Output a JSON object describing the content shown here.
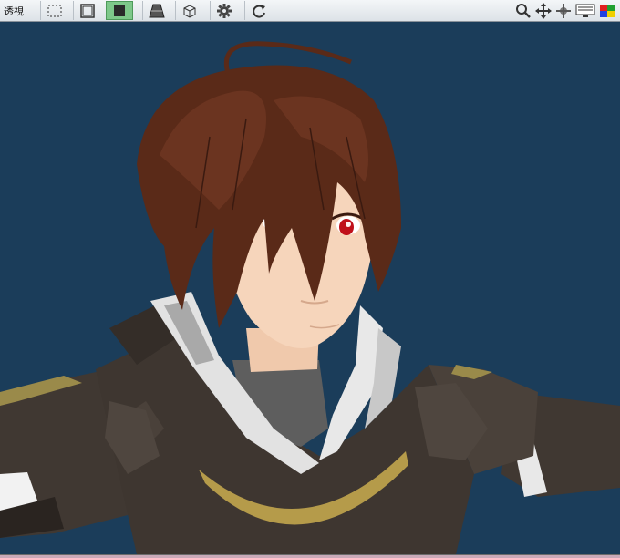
{
  "toolbar": {
    "view_mode_label": "透視",
    "buttons": [
      {
        "name": "select-rect-button",
        "icon": "dashed-square-icon",
        "active": false
      },
      {
        "name": "frame-button",
        "icon": "frame-square-icon",
        "active": false
      },
      {
        "name": "solid-shading-button",
        "icon": "solid-square-icon",
        "active": true
      },
      {
        "name": "texture-shading-button",
        "icon": "trapezoid-icon",
        "active": false
      },
      {
        "name": "wireframe-cube-button",
        "icon": "cube-icon",
        "active": false
      },
      {
        "name": "settings-button",
        "icon": "gear-icon",
        "active": false
      },
      {
        "name": "refresh-button",
        "icon": "refresh-icon",
        "active": false
      }
    ],
    "right_tools": [
      "zoom-icon",
      "pan-icon",
      "rotate-icon",
      "monitor-icon",
      "color-palette-icon"
    ]
  },
  "viewport": {
    "background_color": "#1b3d5a",
    "subject": "anime-style-3d-character-model"
  },
  "colors": {
    "active_button": "#7ec88a",
    "hair": "#5a2a18",
    "skin": "#f6d5bb",
    "coat": "#3e3630",
    "collar": "#e2e2e2",
    "gold_trim": "#b59b4a",
    "eyes": "#c0101a"
  }
}
